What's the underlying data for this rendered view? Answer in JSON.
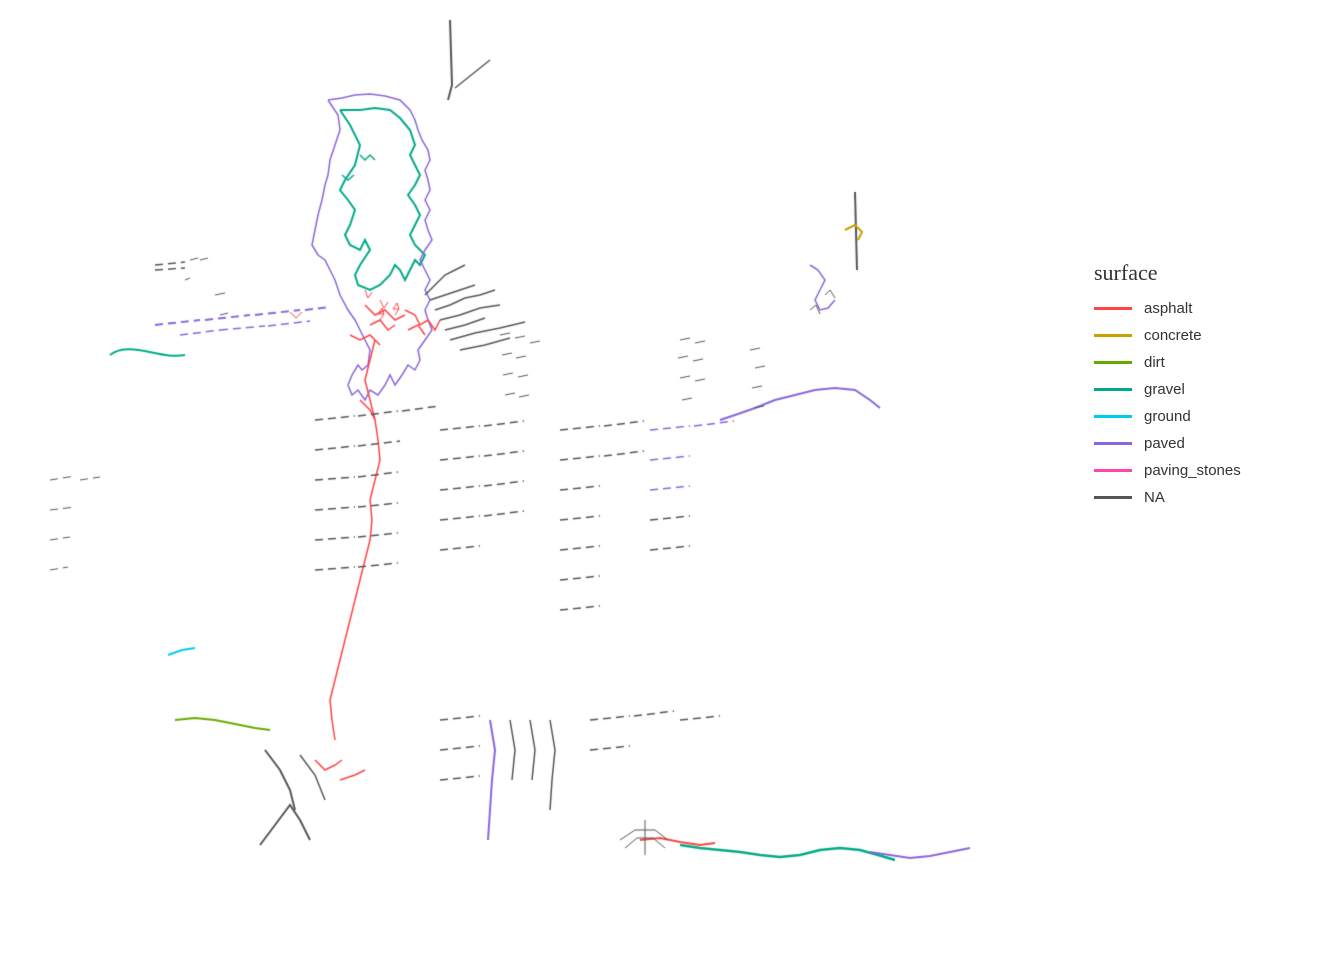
{
  "legend": {
    "title": "surface",
    "items": [
      {
        "label": "asphalt",
        "color": "#FF4444"
      },
      {
        "label": "concrete",
        "color": "#C8A000"
      },
      {
        "label": "dirt",
        "color": "#66AA00"
      },
      {
        "label": "gravel",
        "color": "#00AA88"
      },
      {
        "label": "ground",
        "color": "#00CCEE"
      },
      {
        "label": "paved",
        "color": "#8866DD"
      },
      {
        "label": "paving_stones",
        "color": "#FF44AA"
      },
      {
        "label": "NA",
        "color": "#555555"
      }
    ]
  }
}
